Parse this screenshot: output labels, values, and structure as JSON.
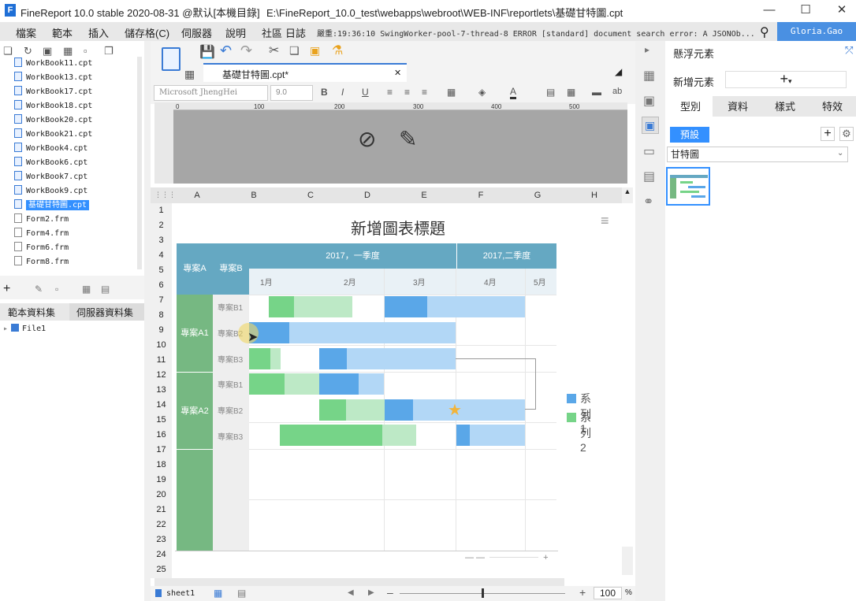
{
  "window": {
    "app_title": "FineReport 10.0 stable 2020-08-31 @默认[本機目錄]",
    "path": "E:\\FineReport_10.0_test\\webapps\\webroot\\WEB-INF\\reportlets\\基礎甘特圖.cpt",
    "min": "—",
    "max": "☐",
    "close": "✕"
  },
  "menu": [
    "檔案",
    "範本",
    "插入",
    "儲存格(C)",
    "伺服器",
    "說明",
    "社區",
    "日誌"
  ],
  "log_text": "嚴重:19:36:10 SwingWorker-pool-7-thread-8 ERROR [standard] document search error: A JSONOb...",
  "user": "Gloria.Gao",
  "files": [
    "WorkBook11.cpt",
    "WorkBook13.cpt",
    "WorkBook17.cpt",
    "WorkBook18.cpt",
    "WorkBook20.cpt",
    "WorkBook21.cpt",
    "WorkBook4.cpt",
    "WorkBook6.cpt",
    "WorkBook7.cpt",
    "WorkBook9.cpt",
    "基礎甘特圖.cpt",
    "Form2.frm",
    "Form4.frm",
    "Form6.frm",
    "Form8.frm"
  ],
  "dataset_tabs": [
    "範本資料集",
    "伺服器資料集"
  ],
  "dataset_item": "File1",
  "tab": {
    "label": "基礎甘特圖.cpt*",
    "close": "✕"
  },
  "format": {
    "font": "Microsoft JhengHei",
    "size": "9.0"
  },
  "ruler": [
    "0",
    "100",
    "200",
    "300",
    "400",
    "500"
  ],
  "columns": [
    "A",
    "B",
    "C",
    "D",
    "E",
    "F",
    "G",
    "H"
  ],
  "rows": [
    "1",
    "2",
    "3",
    "4",
    "5",
    "6",
    "7",
    "8",
    "9",
    "10",
    "11",
    "12",
    "13",
    "14",
    "15",
    "16",
    "17",
    "18",
    "19",
    "20",
    "21",
    "22",
    "23",
    "24",
    "25"
  ],
  "chart_data": {
    "type": "gantt",
    "title": "新增圖表標題",
    "col_a_header": "專案A",
    "col_b_header": "專案B",
    "year_headers": [
      "2017，一季度",
      "2017,二季度"
    ],
    "month_headers": [
      "1月",
      "2月",
      "3月",
      "4月",
      "5月"
    ],
    "groups": [
      {
        "name": "專案A1",
        "tasks": [
          "專案B1",
          "專案B2",
          "專案B3"
        ]
      },
      {
        "name": "專案A2",
        "tasks": [
          "專案B1",
          "專案B2",
          "專案B3"
        ]
      }
    ],
    "series": [
      {
        "name": "系列1",
        "color": "#5aa7e8"
      },
      {
        "name": "系列2",
        "color": "#76d488"
      }
    ],
    "legend_position": "right"
  },
  "sheet_tab": "sheet1",
  "zoom": "100",
  "zoom_unit": "%",
  "right": {
    "title": "懸浮元素",
    "add_label": "新增元素",
    "tabs": [
      "型別",
      "資料",
      "樣式",
      "特效"
    ],
    "preset": "預設",
    "chart_type": "甘特圖"
  }
}
